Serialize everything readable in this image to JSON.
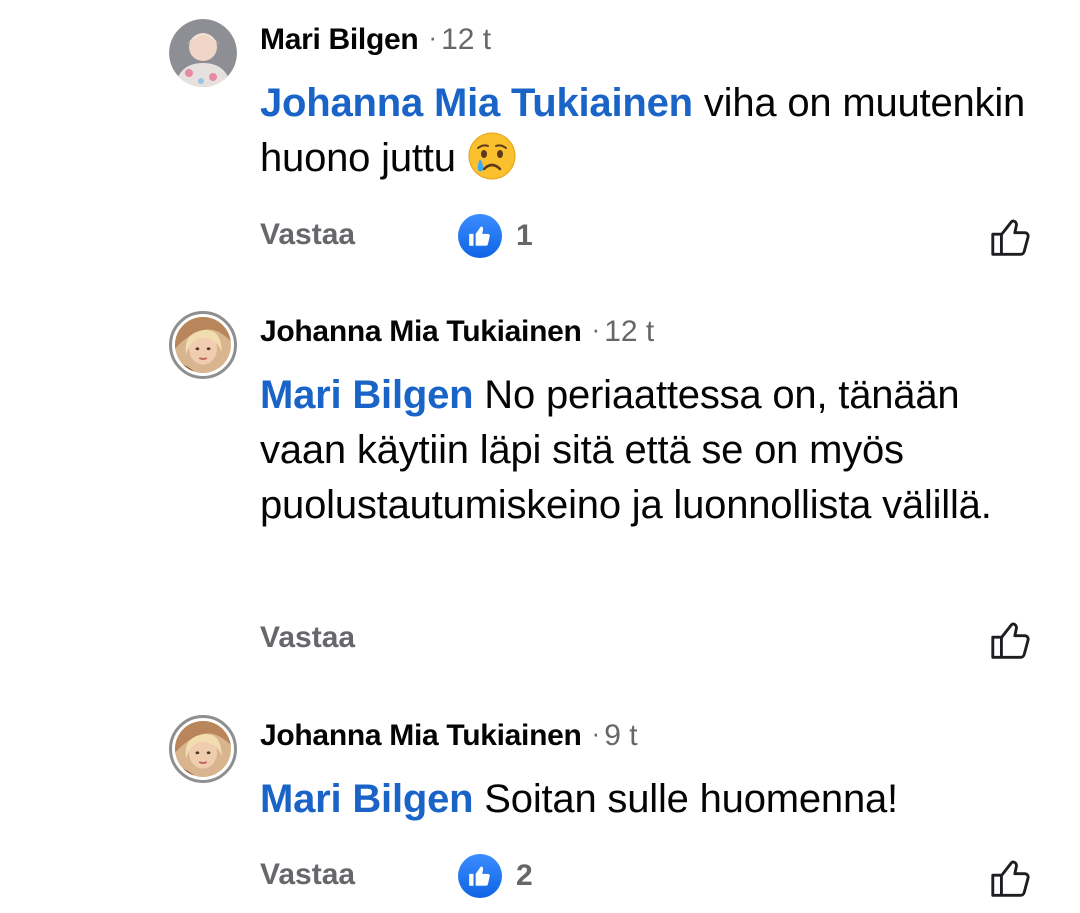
{
  "comments": [
    {
      "author": "Mari Bilgen",
      "time": "12 t",
      "mention": "Johanna Mia Tukiainen",
      "text": " viha on muutenkin huono juttu ",
      "emoji": "crying-face-emoji",
      "reply_label": "Vastaa",
      "reaction_count": "1"
    },
    {
      "author": "Johanna Mia Tukiainen",
      "time": "12 t",
      "mention": "Mari Bilgen",
      "text": " No periaattessa on, tänään vaan käytiin läpi sitä että se on myös puolustautumiskeino ja luonnollista välillä.",
      "reply_label": "Vastaa"
    },
    {
      "author": "Johanna Mia Tukiainen",
      "time": "9 t",
      "mention": "Mari Bilgen",
      "text": " Soitan sulle huomenna!",
      "reply_label": "Vastaa",
      "reaction_count": "2"
    }
  ],
  "separator": "·",
  "icons": {
    "reaction": "like-reaction-icon",
    "like_button": "thumbs-up-outline-icon"
  },
  "colors": {
    "mention": "#1a63c7",
    "meta_gray": "#65676b",
    "like_blue": "#1877f2"
  }
}
